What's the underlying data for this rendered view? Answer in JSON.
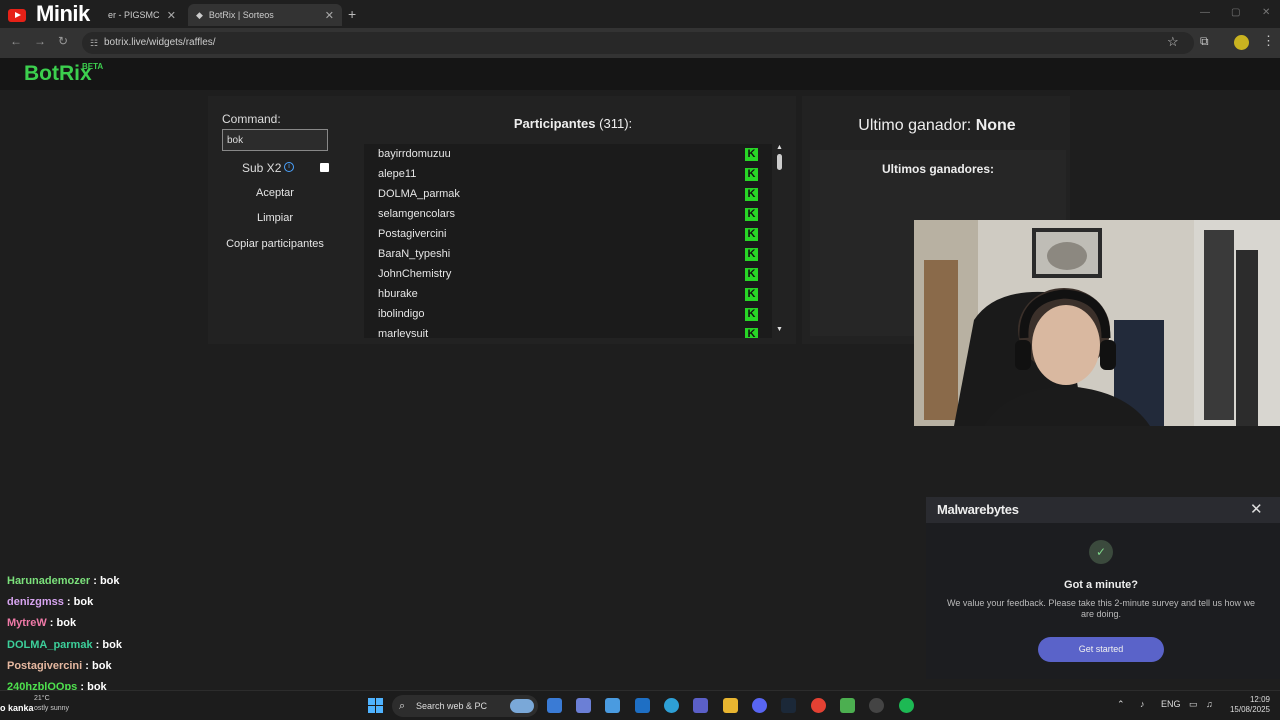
{
  "browser": {
    "tab1_title": "er - PIGSMC",
    "tab2_title": "BotRix | Sorteos",
    "url": "botrix.live/widgets/raffles/",
    "overlay_name": "Minik"
  },
  "app": {
    "brand": "BotRix",
    "beta": "BETA",
    "command_label": "Command:",
    "command_value": "bok",
    "sub_label": "Sub X2",
    "accept_label": "Aceptar",
    "clear_label": "Limpiar",
    "copy_label": "Copiar participantes",
    "participants_title": "Participantes",
    "participants_count": "(311):",
    "participants": [
      "bayirrdomuzuu",
      "alepe11",
      "DOLMA_parmak",
      "selamgencolars",
      "Postagivercini",
      "BaraN_typeshi",
      "JohnChemistry",
      "hburake",
      "ibolindigo",
      "marleysuit"
    ],
    "platform_badge": "K",
    "last_winner_label": "Ultimo ganador:",
    "last_winner_value": "None",
    "last_winners_title": "Ultimos ganadores:"
  },
  "chat": [
    {
      "user": "Harunademozer",
      "msg": "bok",
      "color": "#7be07b"
    },
    {
      "user": "denizgmss",
      "msg": "bok",
      "color": "#d7a4f0"
    },
    {
      "user": "MytreW",
      "msg": "bok",
      "color": "#f07aa8"
    },
    {
      "user": "DOLMA_parmak",
      "msg": "bok",
      "color": "#3ccf9a"
    },
    {
      "user": "Postagivercini",
      "msg": "bok",
      "color": "#e6b8a0"
    },
    {
      "user": "240hzblOOps",
      "msg": "bok",
      "color": "#4ee04e"
    }
  ],
  "chat_separator": ":",
  "malwarebytes": {
    "logo": "Malwarebytes",
    "question": "Got a minute?",
    "text": "We value your feedback. Please take this 2-minute survey and tell us how we are doing.",
    "button": "Get started"
  },
  "taskbar": {
    "weather_label": "o kanka",
    "weather_temp": "21°C",
    "weather_desc": "ostly sunny",
    "search_placeholder": "Search web & PC",
    "lang": "ENG",
    "time": "12:09",
    "date": "15/08/2025"
  },
  "colors": {
    "brand_green": "#3ccf4e",
    "kick_green": "#28d626",
    "mb_button": "#5a63c9"
  }
}
